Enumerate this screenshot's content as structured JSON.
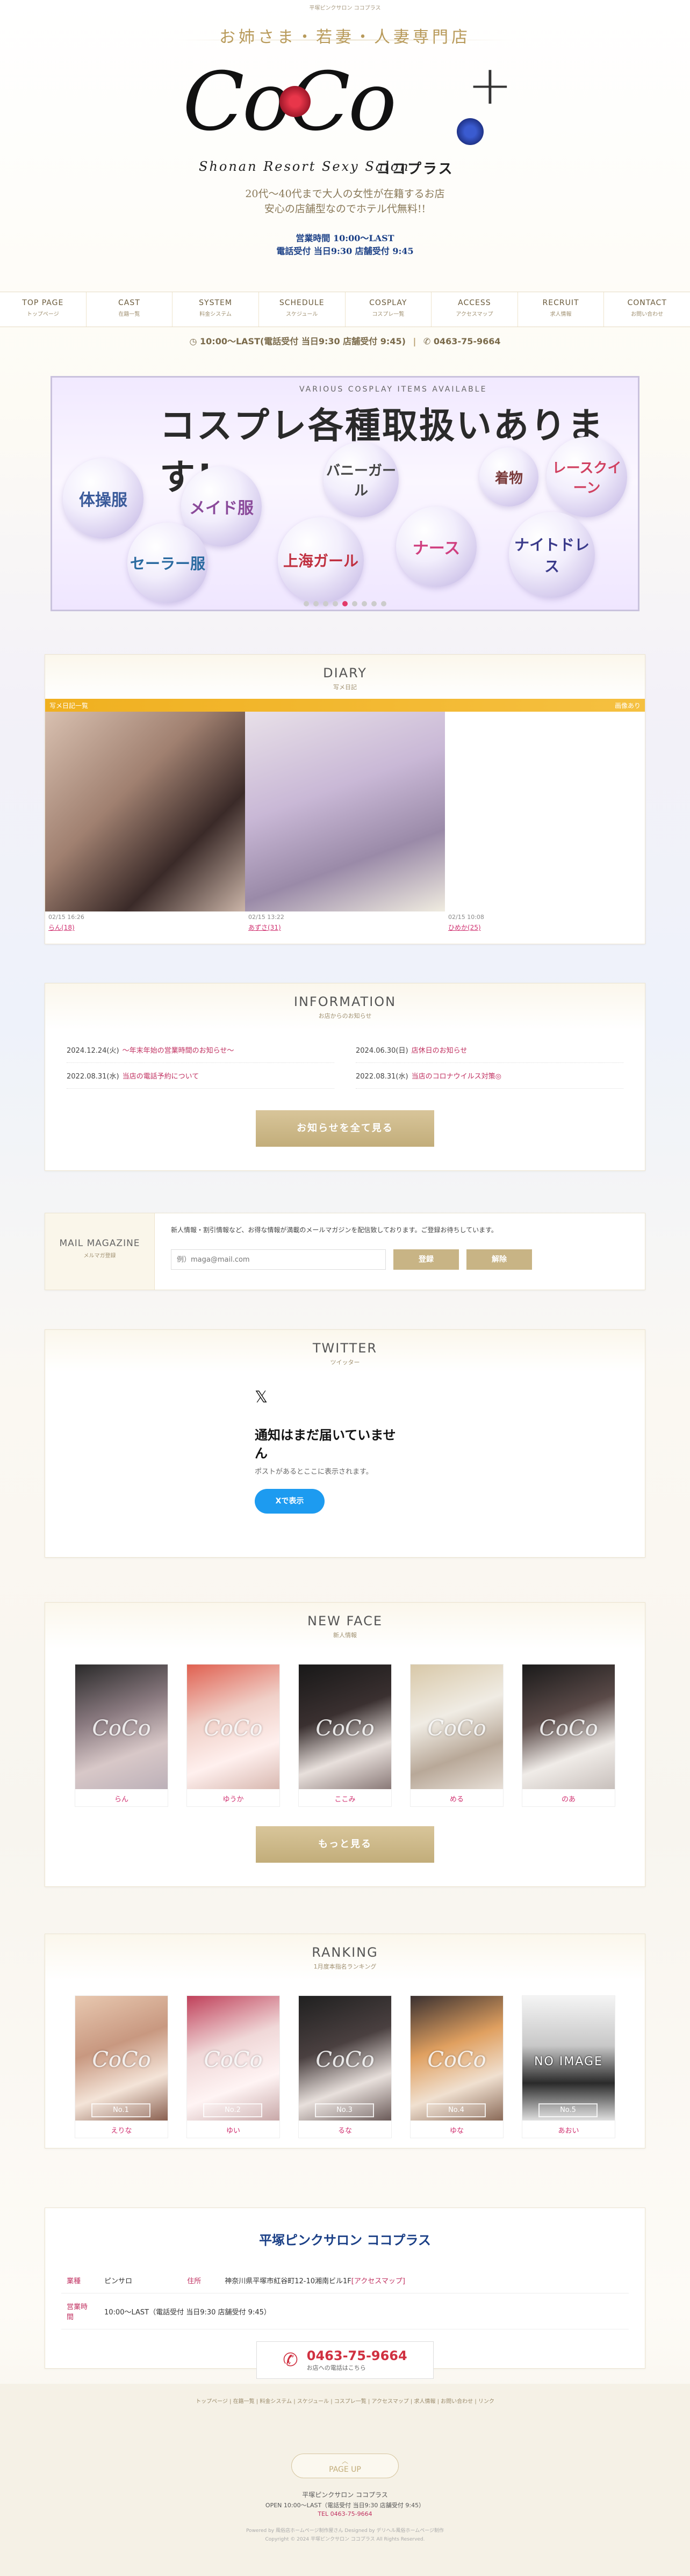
{
  "top_note": "平塚ピンクサロン ココプラス",
  "header": {
    "tagline": "お姉さま・若妻・人妻専門店",
    "logo_text": "CoCo",
    "subtitle_en": "Shonan Resort Sexy Salon",
    "subtitle_jp": "ココプラス",
    "desc_line1": "20代～40代まで大人の女性が在籍するお店",
    "desc_line2": "安心の店舗型なのでホテル代無料!!",
    "hours_line1": "営業時間 10:00～LAST",
    "hours_line2": "電話受付 当日9:30 店舗受付 9:45"
  },
  "nav": [
    {
      "en": "TOP PAGE",
      "jp": "トップページ"
    },
    {
      "en": "CAST",
      "jp": "在籍一覧"
    },
    {
      "en": "SYSTEM",
      "jp": "料金システム"
    },
    {
      "en": "SCHEDULE",
      "jp": "スケジュール"
    },
    {
      "en": "COSPLAY",
      "jp": "コスプレ一覧"
    },
    {
      "en": "ACCESS",
      "jp": "アクセスマップ"
    },
    {
      "en": "RECRUIT",
      "jp": "求人情報"
    },
    {
      "en": "CONTACT",
      "jp": "お問い合わせ"
    }
  ],
  "infobar": {
    "hours": "10:00～LAST(電話受付 当日9:30 店舗受付 9:45)",
    "phone": "0463-75-9664"
  },
  "banner": {
    "title": "コスプレ各種取扱いあります!",
    "sub": "VARIOUS COSPLAY ITEMS AVAILABLE",
    "items": [
      "体操服",
      "メイド服",
      "バニーガール",
      "着物",
      "レースクイーン",
      "セーラー服",
      "上海ガール",
      "ナース",
      "ナイトドレス"
    ]
  },
  "diary": {
    "title": "DIARY",
    "sub": "写メ日記",
    "bar_left": "写メ日記一覧",
    "bar_right": "画像あり",
    "cards": [
      {
        "date": "02/15 16:26",
        "name": "らん(18)"
      },
      {
        "date": "02/15 13:22",
        "name": "あずさ(31)"
      },
      {
        "date": "02/15 10:08",
        "name": "ひめか(25)"
      }
    ]
  },
  "information": {
    "title": "INFORMATION",
    "sub": "お店からのお知らせ",
    "items": [
      {
        "date": "2024.12.24(火)",
        "text": "～年末年始の営業時間のお知らせ～"
      },
      {
        "date": "2024.06.30(日)",
        "text": "店休日のお知らせ"
      },
      {
        "date": "2022.08.31(水)",
        "text": "当店の電話予約について"
      },
      {
        "date": "2022.08.31(水)",
        "text": "当店のコロナウイルス対策◎"
      }
    ],
    "button": "お知らせを全て見る"
  },
  "mail": {
    "title": "MAIL MAGAZINE",
    "sub": "メルマガ登録",
    "desc": "新人情報・割引情報など、お得な情報が満載のメールマガジンを配信致しております。ご登録お待ちしています。",
    "placeholder": "例）maga@mail.com",
    "register": "登録",
    "cancel": "解除"
  },
  "twitter": {
    "title": "TWITTER",
    "sub": "ツイッター",
    "x_logo": "𝕏",
    "empty_title": "通知はまだ届いていませ\nん",
    "empty_desc": "ポストがあるとここに表示されます。",
    "button": "Xで表示"
  },
  "new_face": {
    "title": "NEW FACE",
    "sub": "新人情報",
    "cards": [
      {
        "name": "らん"
      },
      {
        "name": "ゆうか"
      },
      {
        "name": "ここみ"
      },
      {
        "name": "める"
      },
      {
        "name": "のあ"
      }
    ],
    "button": "もっと見る"
  },
  "ranking": {
    "title": "RANKING",
    "sub": "1月度本指名ランキング",
    "watermark": "CoCo",
    "cards": [
      {
        "no": "No.1",
        "name": "えりな"
      },
      {
        "no": "No.2",
        "name": "ゆい"
      },
      {
        "no": "No.3",
        "name": "るな"
      },
      {
        "no": "No.4",
        "name": "ゆな"
      },
      {
        "no": "No.5",
        "name": "あおい",
        "noimage": "NO IMAGE"
      }
    ]
  },
  "shop": {
    "title": "平塚ピンクサロン ココプラス",
    "type_label": "業種",
    "type": "ピンサロ",
    "addr_label": "住所",
    "addr": "神奈川県平塚市紅谷町12-10湘南ビル1F",
    "addr_link": "[アクセスマップ]",
    "hours_label": "営業時間",
    "hours": "10:00～LAST（電話受付 当日9:30 店舗受付 9:45）",
    "tel": "0463-75-9664",
    "tel_sub": "お店への電話はこちら"
  },
  "footer": {
    "links": "トップページ | 在籍一覧 | 料金システム | スケジュール | コスプレ一覧 | アクセスマップ | 求人情報 | お問い合わせ | リンク",
    "pageup": "PAGE UP",
    "shop_name": "平塚ピンクサロン ココプラス",
    "open": "OPEN 10:00～LAST（電話受付 当日9:30 店舗受付 9:45）",
    "tel": "TEL 0463-75-9664",
    "powered": "Powered by 風俗店ホームページ制作屋さん  Designed by デリヘル風俗ホームページ制作",
    "copyright": "Copyright © 2024 平塚ピンクサロン ココプラス All Rights Reserved."
  }
}
